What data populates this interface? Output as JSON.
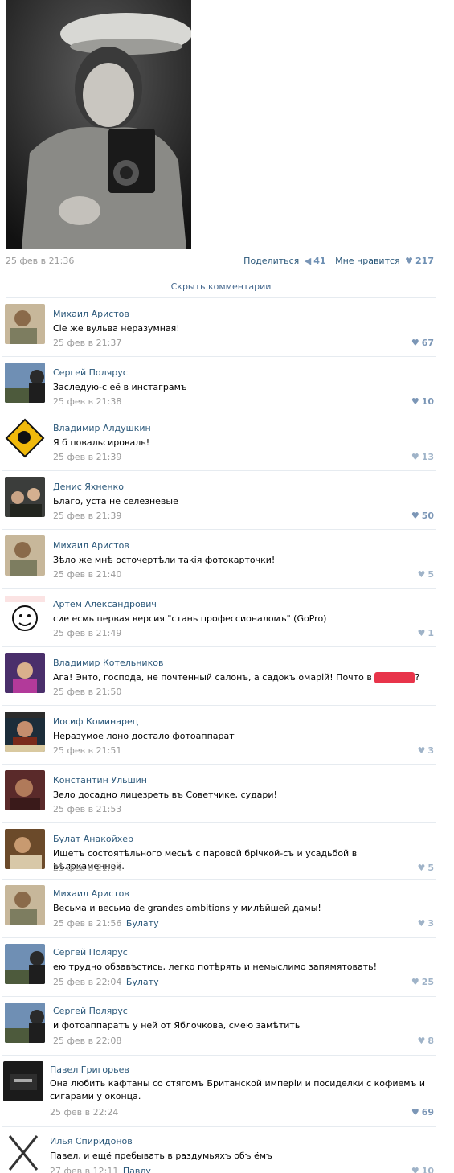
{
  "post": {
    "date": "25 фев в 21:36",
    "share_label": "Поделиться",
    "share_count": "41",
    "like_label": "Мне нравится",
    "like_count": "217",
    "share_icon": "megaphone-icon",
    "like_icon": "heart-icon"
  },
  "hide_comments_label": "Скрыть комментарии",
  "colors": {
    "link": "#2b587a",
    "date": "#999999",
    "like": "#7b96b6",
    "separator": "#e6ebf0"
  },
  "comments": [
    {
      "author": "Михаил Аристов",
      "text": "Сіе же вульва неразумная!",
      "date": "25 фев в 21:37",
      "reply_to": "",
      "likes": "67"
    },
    {
      "author": "Сергей Полярус",
      "text": "Заследую-с её в инстаграмъ",
      "date": "25 фев в 21:38",
      "reply_to": "",
      "likes": "10"
    },
    {
      "author": "Владимир Алдушкин",
      "text": "Я б повальсироваль!",
      "date": "25 фев в 21:39",
      "reply_to": "",
      "likes": "13"
    },
    {
      "author": "Денис Яхненко",
      "text": "Благо, уста не селезневые",
      "date": "25 фев в 21:39",
      "reply_to": "",
      "likes": "50"
    },
    {
      "author": "Михаил Аристов",
      "text": "Зѣло же мнѣ осточертѣли такія фотокарточки!",
      "date": "25 фев в 21:40",
      "reply_to": "",
      "likes": "5"
    },
    {
      "author": "Артём Александрович",
      "text": "сие есмь первая версия \"стань профессионаломъ\" (GoPro)",
      "date": "25 фев в 21:49",
      "reply_to": "",
      "likes": "1"
    },
    {
      "author": "Владимир Котельников",
      "text": "Ага! Энто, господа, не почтенный салонъ, а садокъ омарій! Почто в",
      "text_tail": "?",
      "date": "25 фев в 21:50",
      "reply_to": "",
      "likes": ""
    },
    {
      "author": "Иосиф Коминарец",
      "text": "Неразумое лоно достало фотоаппарат",
      "date": "25 фев в 21:51",
      "reply_to": "",
      "likes": "3"
    },
    {
      "author": "Константин Ульшин",
      "text": "Зело досадно лицезреть въ Советчике, судари!",
      "date": "25 фев в 21:53",
      "reply_to": "",
      "likes": ""
    },
    {
      "author": "Булат Анакойхер",
      "text": "Ищетъ состоятѣльного месьѣ с паровой брічкой-съ и усадьбой в Бѣлокаменной.",
      "date": "25 фев в 21:54",
      "reply_to": "",
      "likes": "5"
    },
    {
      "author": "Михаил Аристов",
      "text": "Весьма и весьма de grandes ambitions у милѣйшей дамы!",
      "date": "25 фев в 21:56",
      "reply_to": "Булату",
      "likes": "3"
    },
    {
      "author": "Сергей Полярус",
      "text": "ею трудно обзавѣстись, легко потѣрять и немыслимо запямятовать!",
      "date": "25 фев в 22:04",
      "reply_to": "Булату",
      "likes": "25"
    },
    {
      "author": "Сергей Полярус",
      "text": "и фотоаппаратъ у ней от Яблочкова, смею замѣтить",
      "date": "25 фев в 22:08",
      "reply_to": "",
      "likes": "8"
    },
    {
      "author": "Павел Григорьев",
      "text": "Она любить кафтаны со стягомъ Британской имперіи и посиделки с кофиемъ и сигарами у оконца.",
      "date": "25 фев в 22:24",
      "reply_to": "",
      "likes": "69"
    },
    {
      "author": "Илья Спиридонов",
      "text": "Павел, и ещё пребывать в раздумьяхъ объ ёмъ",
      "date": "27 фев в 12:11",
      "reply_to": "Павлу",
      "likes": "10"
    }
  ]
}
